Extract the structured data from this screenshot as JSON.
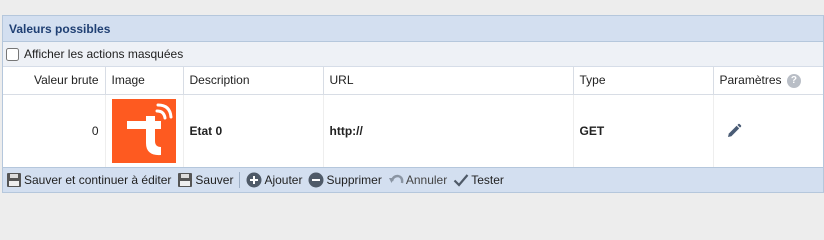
{
  "panel": {
    "title": "Valeurs possibles",
    "show_hidden_label": "Afficher les actions masquées"
  },
  "table": {
    "headers": {
      "raw_value": "Valeur brute",
      "image": "Image",
      "description": "Description",
      "url": "URL",
      "type": "Type",
      "params": "Paramètres"
    },
    "rows": [
      {
        "raw_value": "0",
        "image": "tuya-logo",
        "description": "Etat 0",
        "url": "http://",
        "type": "GET"
      }
    ]
  },
  "toolbar": {
    "save_continue": "Sauver et continuer à éditer",
    "save": "Sauver",
    "add": "Ajouter",
    "delete": "Supprimer",
    "cancel": "Annuler",
    "test": "Tester"
  },
  "colors": {
    "accent": "#1f3f73",
    "logo": "#fe5a20"
  }
}
